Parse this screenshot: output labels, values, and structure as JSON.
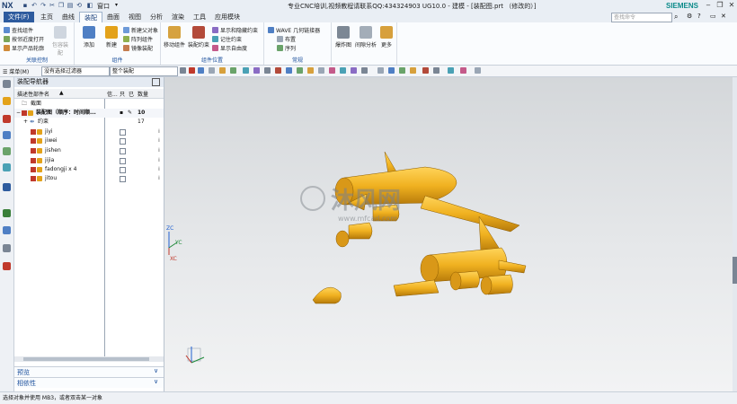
{
  "app": {
    "logo": "NX",
    "window_title": "专业CNC培训,视频教程请联系QQ:434324903 UG10.0 - 建模 - [装配图.prt （修改的）]",
    "vendor": "SIEMENS"
  },
  "quick_access": {
    "window_menu": "窗口"
  },
  "menu": {
    "file": "文件(F)",
    "tabs": [
      "主页",
      "曲线",
      "装配",
      "曲面",
      "视图",
      "分析",
      "渲染",
      "工具",
      "应用模块"
    ],
    "active": "装配",
    "search_placeholder": "查找命令"
  },
  "ribbon": {
    "groups": [
      {
        "label": "关联控制",
        "items": [
          "查找组件",
          "按邻近度打开",
          "显示产品轮廓"
        ],
        "side": "包容装配"
      },
      {
        "label": "组件",
        "big": [
          "添加",
          "新建"
        ],
        "items": [
          "新建父对象",
          "阵列组件",
          "镜像装配"
        ]
      },
      {
        "label": "组件位置",
        "big": [
          "移动组件",
          "装配约束"
        ],
        "items": [
          "显示和隐藏约束",
          "记住约束",
          "显示自由度"
        ]
      },
      {
        "label": "常规",
        "items": [
          "WAVE 几何链接器",
          "布置",
          "序列"
        ]
      },
      {
        "label": "",
        "big": [
          "爆炸图",
          "间隙分析",
          "更多"
        ]
      }
    ]
  },
  "toolbar": {
    "menu_label": "菜单(M)",
    "filter": "没有选择过滤器",
    "scope": "整个装配"
  },
  "navigator": {
    "title": "装配导航器",
    "columns": [
      "描述性部件名",
      "信...",
      "只",
      "已",
      "数量"
    ],
    "rows": [
      {
        "name": "截面",
        "level": 0,
        "type": "folder"
      },
      {
        "name": "装配图（顺序：时间顺...",
        "level": 0,
        "type": "assembly",
        "qty": "10"
      },
      {
        "name": "约束",
        "level": 1,
        "type": "constraint",
        "qty": "17"
      },
      {
        "name": "jiyi",
        "level": 1,
        "type": "part"
      },
      {
        "name": "jiwei",
        "level": 1,
        "type": "part"
      },
      {
        "name": "jishen",
        "level": 1,
        "type": "part"
      },
      {
        "name": "jijia",
        "level": 1,
        "type": "part"
      },
      {
        "name": "fadongji x 4",
        "level": 1,
        "type": "part"
      },
      {
        "name": "jitou",
        "level": 1,
        "type": "part"
      }
    ],
    "panels": [
      "预览",
      "相依性"
    ]
  },
  "viewport": {
    "watermark_main": "沐风网",
    "watermark_url": "www.mfcad.com",
    "axes": {
      "z": "ZC",
      "y": "YC",
      "x": "XC"
    }
  },
  "status": {
    "text": "选择对象并使用 MB3，或者双击某一对象"
  },
  "colors": {
    "part": "#e3a21a",
    "part_dark": "#b67a0a",
    "accent": "#2d5b9e"
  }
}
